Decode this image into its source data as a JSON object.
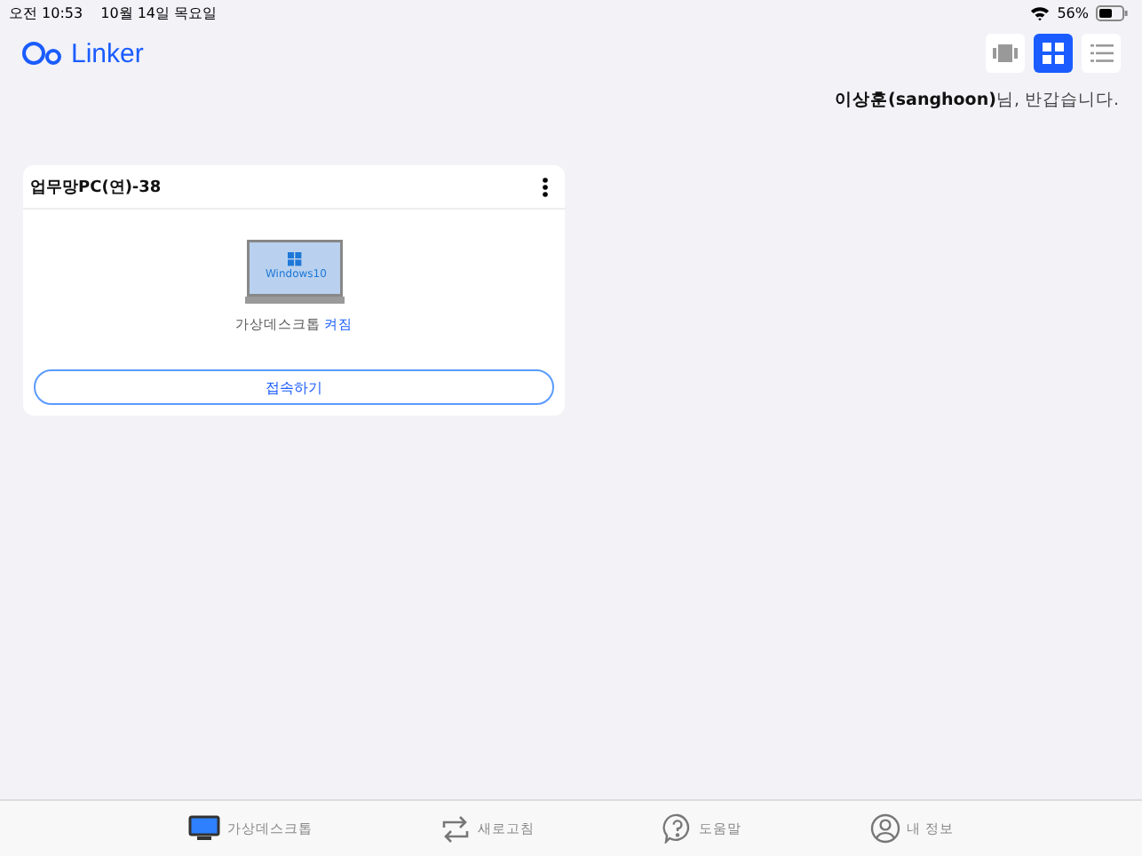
{
  "status_bar": {
    "time": "오전 10:53",
    "date": "10월 14일 목요일",
    "battery": "56%"
  },
  "app": {
    "logo": "Linker"
  },
  "view_modes": [
    {
      "kind": "carousel",
      "selected": false
    },
    {
      "kind": "grid",
      "selected": true
    },
    {
      "kind": "list",
      "selected": false
    }
  ],
  "greeting": {
    "text": "**이상훈(sanghoon)**님, 반갑습니다."
  },
  "desktops": [
    {
      "name": "업무망PC(연)-38",
      "os_label": "Windows10",
      "status_text": "가상데스크톱",
      "status": "켜짐",
      "connect_button": "접속하기"
    }
  ],
  "tab_bar": [
    {
      "kind": "desktops",
      "label": "가상데스크톱",
      "selected": true
    },
    {
      "kind": "refresh",
      "label": "새로고침",
      "selected": false
    },
    {
      "kind": "help",
      "label": "도움말",
      "selected": false
    },
    {
      "kind": "profile",
      "label": "내 정보",
      "selected": false
    }
  ]
}
